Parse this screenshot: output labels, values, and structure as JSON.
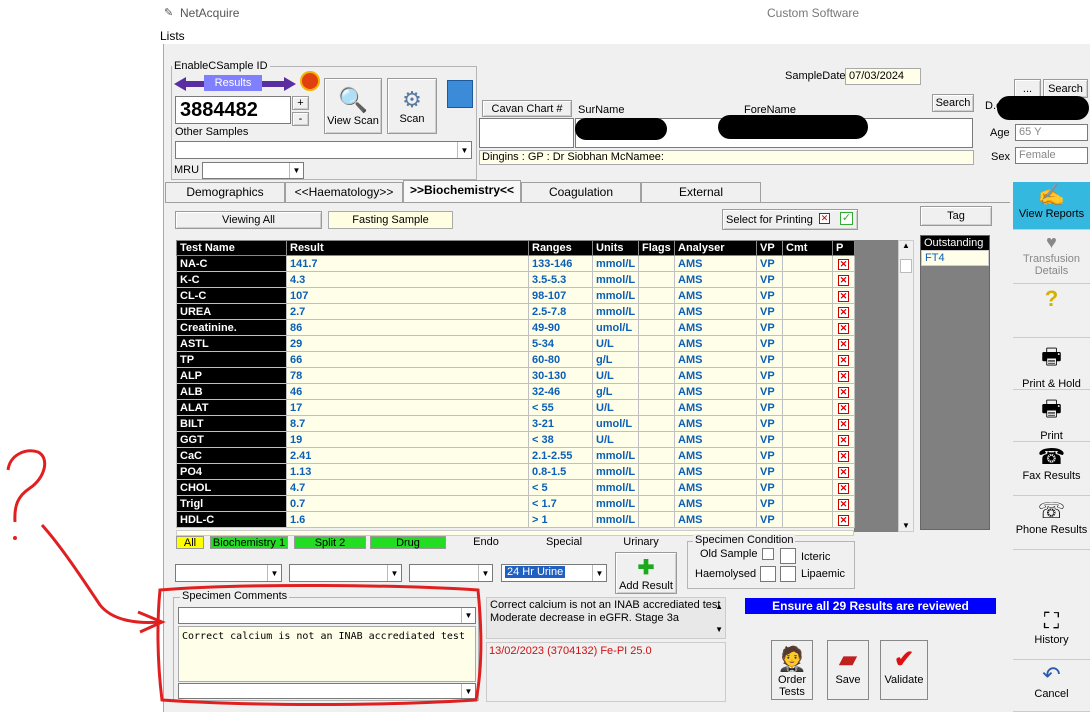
{
  "window": {
    "title": "NetAcquire",
    "subtitle": "Custom Software"
  },
  "menu": {
    "lists": "Lists"
  },
  "sample": {
    "group_label": "EnableCSample ID",
    "results_label": "Results",
    "sample_id": "3884482",
    "plus": "+",
    "minus": "-",
    "other_samples": "Other Samples",
    "mru": "MRU",
    "view_scan": "View Scan",
    "scan": "Scan"
  },
  "patient": {
    "sample_date_label": "SampleDate",
    "sample_date": "07/03/2024",
    "cavan_chart": "Cavan Chart #",
    "surname": "SurName",
    "forename": "ForeName",
    "search1": "Search",
    "ellipsis": "...",
    "search2": "Search",
    "dob_label": "D.o",
    "age_label": "Age",
    "age": "65 Y",
    "sex_label": "Sex",
    "sex": "Female",
    "gp_line": "Dingins : GP : Dr Siobhan McNamee:"
  },
  "tabs": [
    "Demographics",
    "<<Haematology>>",
    ">>Biochemistry<<",
    "Coagulation",
    "External"
  ],
  "grid_header": {
    "viewing_all": "Viewing All",
    "fasting": "Fasting Sample",
    "select_printing": "Select for Printing",
    "tag": "Tag",
    "outstanding": "Outstanding",
    "outstanding_item": "FT4"
  },
  "columns": [
    "Test Name",
    "Result",
    "Ranges",
    "Units",
    "Flags",
    "Analyser",
    "VP",
    "Cmt",
    "P"
  ],
  "rows": [
    [
      "NA-C",
      "141.7",
      "133-146",
      "mmol/L",
      "",
      "AMS",
      "VP"
    ],
    [
      "K-C",
      "4.3",
      "3.5-5.3",
      "mmol/L",
      "",
      "AMS",
      "VP"
    ],
    [
      "CL-C",
      "107",
      "98-107",
      "mmol/L",
      "",
      "AMS",
      "VP"
    ],
    [
      "UREA",
      "2.7",
      "2.5-7.8",
      "mmol/L",
      "",
      "AMS",
      "VP"
    ],
    [
      "Creatinine.",
      "86",
      "49-90",
      "umol/L",
      "",
      "AMS",
      "VP"
    ],
    [
      "ASTL",
      "29",
      "5-34",
      "U/L",
      "",
      "AMS",
      "VP"
    ],
    [
      "TP",
      "66",
      "60-80",
      "g/L",
      "",
      "AMS",
      "VP"
    ],
    [
      "ALP",
      "78",
      "30-130",
      "U/L",
      "",
      "AMS",
      "VP"
    ],
    [
      "ALB",
      "46",
      "32-46",
      "g/L",
      "",
      "AMS",
      "VP"
    ],
    [
      "ALAT",
      "17",
      "< 55",
      "U/L",
      "",
      "AMS",
      "VP"
    ],
    [
      "BILT",
      "8.7",
      "3-21",
      "umol/L",
      "",
      "AMS",
      "VP"
    ],
    [
      "GGT",
      "19",
      "< 38",
      "U/L",
      "",
      "AMS",
      "VP"
    ],
    [
      "CaC",
      "2.41",
      "2.1-2.55",
      "mmol/L",
      "",
      "AMS",
      "VP"
    ],
    [
      "PO4",
      "1.13",
      "0.8-1.5",
      "mmol/L",
      "",
      "AMS",
      "VP"
    ],
    [
      "CHOL",
      "4.7",
      "< 5",
      "mmol/L",
      "",
      "AMS",
      "VP"
    ],
    [
      "Trigl",
      "0.7",
      "< 1.7",
      "mmol/L",
      "",
      "AMS",
      "VP"
    ],
    [
      "HDL-C",
      "1.6",
      "> 1",
      "mmol/L",
      "",
      "AMS",
      "VP"
    ]
  ],
  "filters": [
    "All",
    "Biochemistry 1",
    "Split 2",
    "Drug",
    "Endo",
    "Special",
    "Urinary"
  ],
  "specimen_condition": {
    "title": "Specimen Condition",
    "old_sample": "Old Sample",
    "icteric": "Icteric",
    "haemolysed": "Haemolysed",
    "lipaemic": "Lipaemic"
  },
  "add_result": "Add Result",
  "urine_select": "24 Hr Urine",
  "specimen_comments": {
    "title": "Specimen Comments",
    "text": "Correct calcium is not an INAB accrediated test"
  },
  "messages": {
    "line1": "Correct calcium is not an INAB accrediated test",
    "line2": "Moderate decrease in eGFR.  Stage 3a",
    "history": "13/02/2023 (3704132) Fe-PI 25.0",
    "ensure": "Ensure all 29 Results are reviewed"
  },
  "actions": {
    "order": "Order Tests",
    "save": "Save",
    "validate": "Validate"
  },
  "sidebar": [
    "View Reports",
    "Transfusion Details",
    "Print & Hold",
    "Print",
    "Fax Results",
    "Phone Results",
    "History",
    "Cancel"
  ],
  "annotation": {
    "mark": "?"
  },
  "colors": {
    "accent": "#0000ff",
    "annotation": "#e02020",
    "filter_green": "#22dd22",
    "filter_yellow": "#ffff00"
  }
}
